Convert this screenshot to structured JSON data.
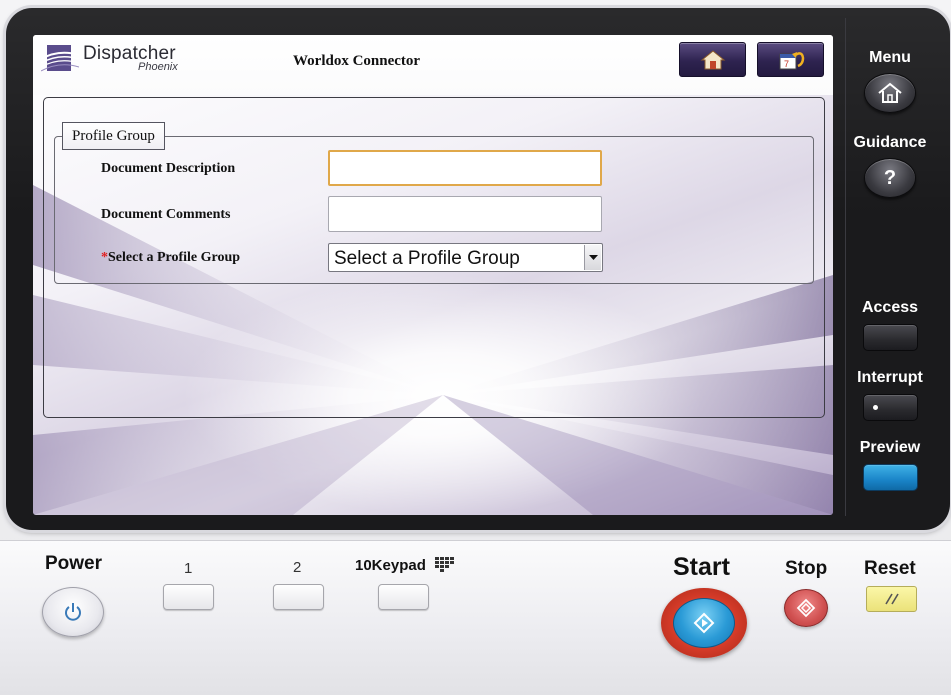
{
  "header": {
    "logo_name": "Dispatcher",
    "logo_sub": "Phoenix",
    "app_title": "Worldox Connector",
    "home_icon": "home-icon",
    "back_icon": "calendar-back-icon"
  },
  "form": {
    "group_legend": "Profile Group",
    "doc_description_label": "Document Description",
    "doc_description_value": "",
    "doc_comments_label": "Document Comments",
    "doc_comments_value": "",
    "required_mark": "*",
    "profile_group_label": "Select a Profile Group",
    "profile_group_selected": "Select a Profile Group"
  },
  "side_panel": {
    "menu": "Menu",
    "guidance": "Guidance",
    "access": "Access",
    "interrupt": "Interrupt",
    "preview": "Preview"
  },
  "bottom_panel": {
    "power": "Power",
    "key1": "1",
    "key2": "2",
    "keypad": "10Keypad",
    "start": "Start",
    "stop": "Stop",
    "reset": "Reset"
  },
  "colors": {
    "header_button": "#2e2350",
    "focus_border": "#e0a84a",
    "required": "#e02020",
    "preview_button": "#1a84c8",
    "start_outer": "#d33a28",
    "start_inner": "#2a9ad6",
    "reset_button": "#ebe27a"
  }
}
